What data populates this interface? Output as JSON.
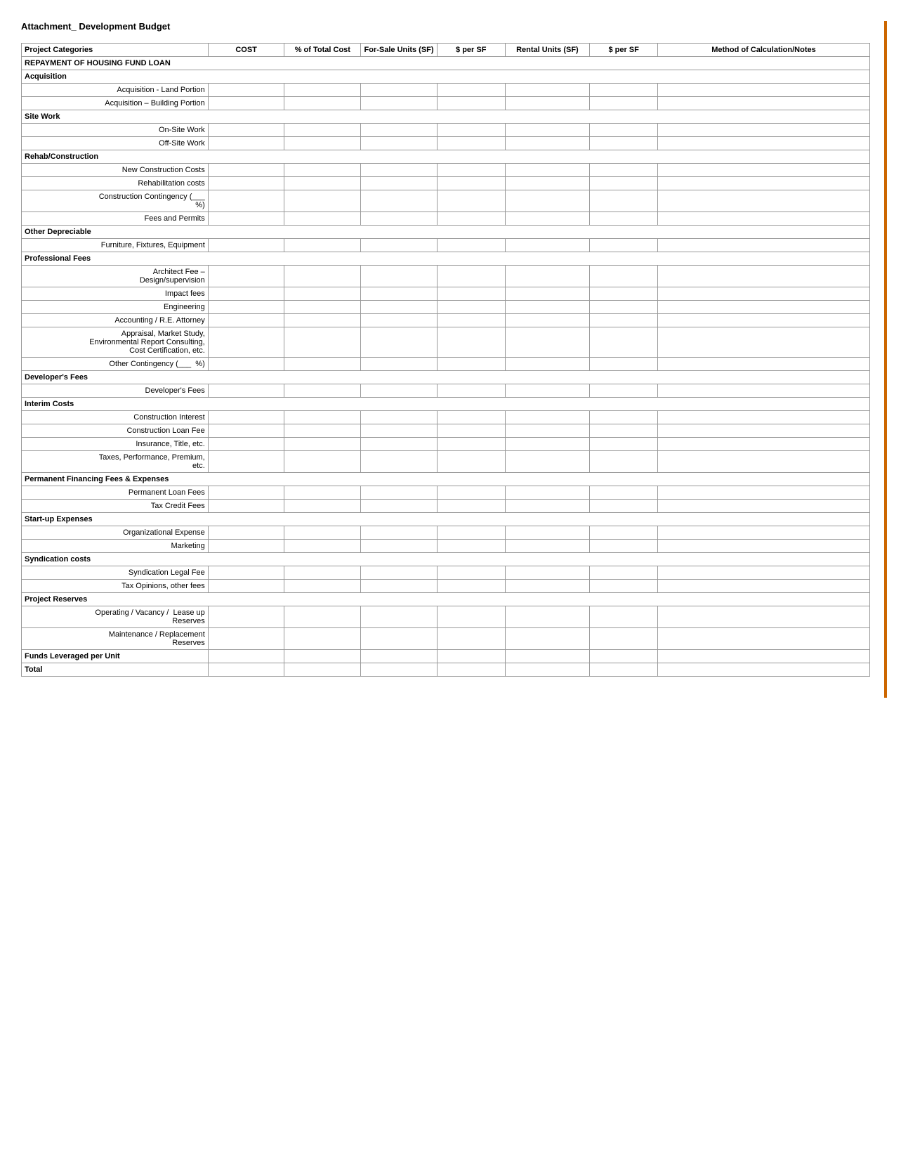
{
  "page": {
    "title": "Attachment_ Development Budget"
  },
  "table": {
    "headers": [
      "Project Categories",
      "COST",
      "% of Total Cost",
      "For-Sale Units (SF)",
      "$ per SF",
      "Rental Units (SF)",
      "$ per SF",
      "Method of Calculation/Notes"
    ],
    "rows": [
      {
        "type": "section",
        "label": "REPAYMENT OF HOUSING FUND LOAN",
        "colspan": true
      },
      {
        "type": "subsection",
        "label": "Acquisition"
      },
      {
        "type": "data",
        "label": "Acquisition - Land Portion"
      },
      {
        "type": "data",
        "label": "Acquisition – Building Portion"
      },
      {
        "type": "subsection",
        "label": "Site Work"
      },
      {
        "type": "data",
        "label": "On-Site Work"
      },
      {
        "type": "data",
        "label": "Off-Site Work"
      },
      {
        "type": "subsection",
        "label": "Rehab/Construction"
      },
      {
        "type": "data",
        "label": "New Construction Costs"
      },
      {
        "type": "data",
        "label": "Rehabilitation costs"
      },
      {
        "type": "data",
        "label": "Construction Contingency (___\n%)"
      },
      {
        "type": "data",
        "label": "Fees and Permits"
      },
      {
        "type": "subsection",
        "label": "Other Depreciable"
      },
      {
        "type": "data",
        "label": "Furniture, Fixtures, Equipment"
      },
      {
        "type": "subsection",
        "label": "Professional Fees"
      },
      {
        "type": "data",
        "label": "Architect Fee –\nDesign/supervision"
      },
      {
        "type": "data",
        "label": "Impact fees"
      },
      {
        "type": "data",
        "label": "Engineering"
      },
      {
        "type": "data",
        "label": "Accounting / R.E. Attorney"
      },
      {
        "type": "data",
        "label": "Appraisal, Market Study,\nEnvironmental Report Consulting,\nCost Certification, etc."
      },
      {
        "type": "data",
        "label": "Other Contingency (___  %)"
      },
      {
        "type": "subsection",
        "label": "Developer's Fees"
      },
      {
        "type": "data",
        "label": "Developer's Fees"
      },
      {
        "type": "subsection",
        "label": "Interim Costs"
      },
      {
        "type": "data",
        "label": "Construction Interest"
      },
      {
        "type": "data",
        "label": "Construction Loan Fee"
      },
      {
        "type": "data",
        "label": "Insurance, Title, etc."
      },
      {
        "type": "data",
        "label": "Taxes, Performance, Premium,\netc."
      },
      {
        "type": "subsection",
        "label": "Permanent Financing Fees & Expenses"
      },
      {
        "type": "data",
        "label": "Permanent Loan Fees"
      },
      {
        "type": "data",
        "label": "Tax Credit Fees"
      },
      {
        "type": "subsection",
        "label": "Start-up Expenses"
      },
      {
        "type": "data",
        "label": "Organizational Expense"
      },
      {
        "type": "data",
        "label": "Marketing"
      },
      {
        "type": "subsection",
        "label": "Syndication costs"
      },
      {
        "type": "data",
        "label": "Syndication Legal Fee"
      },
      {
        "type": "data",
        "label": "Tax Opinions, other fees"
      },
      {
        "type": "subsection",
        "label": "Project Reserves"
      },
      {
        "type": "data",
        "label": "Operating / Vacancy /  Lease up\nReserves"
      },
      {
        "type": "data",
        "label": "Maintenance / Replacement\nReserves"
      },
      {
        "type": "bold",
        "label": "Funds Leveraged per Unit"
      },
      {
        "type": "bold",
        "label": "Total"
      }
    ]
  }
}
